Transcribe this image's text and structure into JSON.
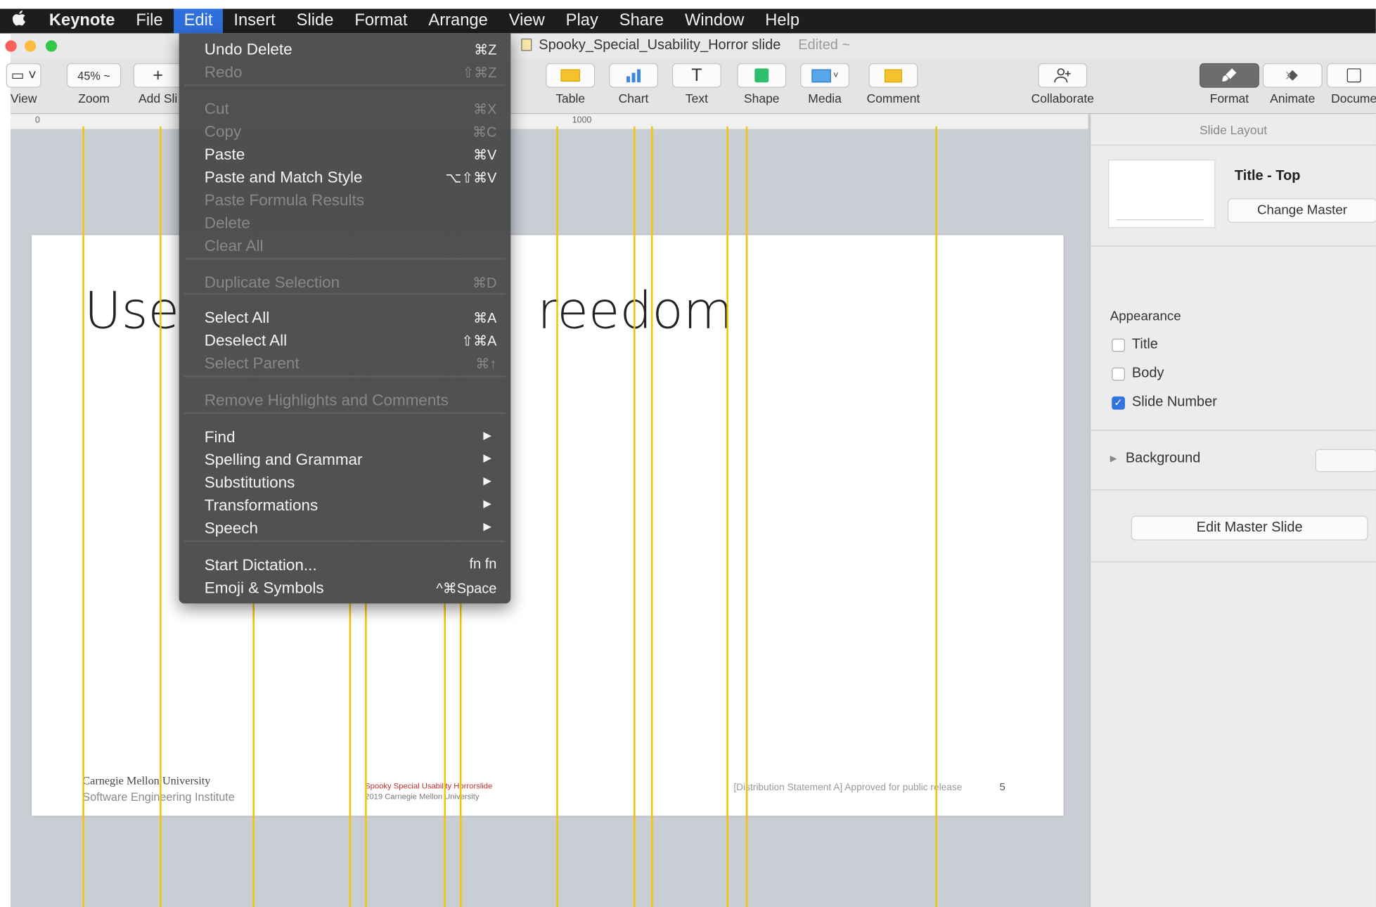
{
  "menubar": {
    "apple": "",
    "items": [
      {
        "label": "Keynote"
      },
      {
        "label": "File"
      },
      {
        "label": "Edit"
      },
      {
        "label": "Insert"
      },
      {
        "label": "Slide"
      },
      {
        "label": "Format"
      },
      {
        "label": "Arrange"
      },
      {
        "label": "View"
      },
      {
        "label": "Play"
      },
      {
        "label": "Share"
      },
      {
        "label": "Window"
      },
      {
        "label": "Help"
      }
    ]
  },
  "window": {
    "doc_title": "Spooky_Special_Usability_Horror slide",
    "edited": "Edited ~"
  },
  "toolbar": {
    "view_label": "View",
    "zoom_value": "45% ~",
    "zoom_label": "Zoom",
    "add_slide_label": "Add Sli",
    "add_slide_glyph": "+",
    "table_label": "Table",
    "chart_label": "Chart",
    "text_label": "Text",
    "text_glyph": "T",
    "shape_label": "Shape",
    "media_label": "Media",
    "comment_label": "Comment",
    "collaborate_label": "Collaborate",
    "format_label": "Format",
    "animate_label": "Animate",
    "document_label": "Docume"
  },
  "ruler": {
    "start": "0",
    "mid": "1000"
  },
  "slide": {
    "title_left": "Use",
    "title_right": "reedom",
    "cmu_line1": "Carnegie Mellon University",
    "cmu_line2": "Software Engineering Institute",
    "mid_line1": "Spooky Special Usability Horrorslide",
    "mid_line2": "2019 Carnegie Mellon University",
    "right_text": "[Distribution Statement A] Approved for public release",
    "number": "5"
  },
  "inspector": {
    "header": "Slide Layout",
    "master_name": "Title - Top",
    "change_master": "Change Master",
    "appearance": "Appearance",
    "cb_title": "Title",
    "cb_body": "Body",
    "cb_slide_number": "Slide Number",
    "background": "Background",
    "edit_master": "Edit Master Slide"
  },
  "edit_menu": [
    {
      "label": "Undo Delete",
      "shortcut": "⌘Z",
      "enabled": true
    },
    {
      "label": "Redo",
      "shortcut": "⇧⌘Z",
      "enabled": false
    },
    {
      "label": "Cut",
      "shortcut": "⌘X",
      "enabled": false
    },
    {
      "label": "Copy",
      "shortcut": "⌘C",
      "enabled": false
    },
    {
      "label": "Paste",
      "shortcut": "⌘V",
      "enabled": true
    },
    {
      "label": "Paste and Match Style",
      "shortcut": "⌥⇧⌘V",
      "enabled": true
    },
    {
      "label": "Paste Formula Results",
      "shortcut": "",
      "enabled": false
    },
    {
      "label": "Delete",
      "shortcut": "",
      "enabled": false
    },
    {
      "label": "Clear All",
      "shortcut": "",
      "enabled": false
    },
    {
      "label": "Duplicate Selection",
      "shortcut": "⌘D",
      "enabled": false
    },
    {
      "label": "Select All",
      "shortcut": "⌘A",
      "enabled": true
    },
    {
      "label": "Deselect All",
      "shortcut": "⇧⌘A",
      "enabled": true
    },
    {
      "label": "Select Parent",
      "shortcut": "⌘↑",
      "enabled": false
    },
    {
      "label": "Remove Highlights and Comments",
      "shortcut": "",
      "enabled": false
    },
    {
      "label": "Find",
      "shortcut": "",
      "enabled": true,
      "submenu": true
    },
    {
      "label": "Spelling and Grammar",
      "shortcut": "",
      "enabled": true,
      "submenu": true
    },
    {
      "label": "Substitutions",
      "shortcut": "",
      "enabled": true,
      "submenu": true
    },
    {
      "label": "Transformations",
      "shortcut": "",
      "enabled": true,
      "submenu": true
    },
    {
      "label": "Speech",
      "shortcut": "",
      "enabled": true,
      "submenu": true
    },
    {
      "label": "Start Dictation...",
      "shortcut": "fn fn",
      "enabled": true
    },
    {
      "label": "Emoji & Symbols",
      "shortcut": "^⌘Space",
      "enabled": true
    }
  ],
  "colors": {
    "menu_highlight": "#2f6fdc",
    "guide": "#f5c400",
    "checkbox": "#2f74e0"
  }
}
